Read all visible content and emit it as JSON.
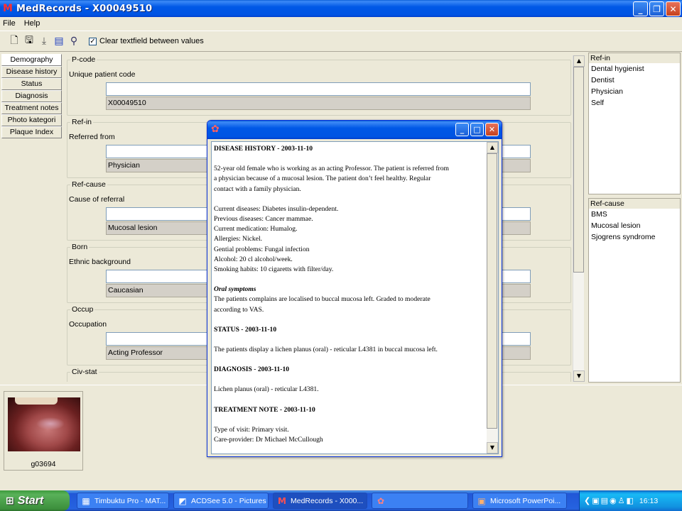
{
  "window": {
    "title": "MedRecords - X00049510",
    "app_icon": "M"
  },
  "menu": [
    "File",
    "Help"
  ],
  "toolbar": {
    "icons": [
      "new-record-icon",
      "save-icon",
      "download-icon",
      "chart-icon",
      "search-icon"
    ],
    "checkbox_label": "Clear textfield between values",
    "checkbox_checked": true
  },
  "nav": [
    "Demography",
    "Disease history",
    "Status",
    "Diagnosis",
    "Treatment notes",
    "Photo kategori",
    "Plaque Index"
  ],
  "form": {
    "groups": [
      {
        "legend": "P-code",
        "label": "Unique patient code",
        "input": "",
        "value": "X00049510"
      },
      {
        "legend": "Ref-in",
        "label": "Referred from",
        "input": "",
        "value": "Physician"
      },
      {
        "legend": "Ref-cause",
        "label": "Cause of referral",
        "input": "",
        "value": "Mucosal lesion"
      },
      {
        "legend": "Born",
        "label": "Ethnic background",
        "input": "",
        "value": "Caucasian"
      },
      {
        "legend": "Occup",
        "label": "Occupation",
        "input": "",
        "value": "Acting Professor"
      },
      {
        "legend": "Civ-stat",
        "label": "",
        "input": "",
        "value": ""
      }
    ]
  },
  "right_panels": {
    "ref_in": {
      "title": "Ref-in",
      "items": [
        "Dental hygienist",
        "Dentist",
        "Physician",
        "Self"
      ]
    },
    "ref_cause": {
      "title": "Ref-cause",
      "items": [
        "BMS",
        "Mucosal lesion",
        "Sjogrens syndrome"
      ]
    }
  },
  "photo": {
    "caption": "g03694"
  },
  "popup": {
    "icon": "✿",
    "lines": [
      {
        "style": "h",
        "text": "DISEASE HISTORY - 2003-11-10"
      },
      {
        "style": "gap",
        "text": ""
      },
      {
        "style": "p",
        "text": "52-year old female who is working as an acting Professor. The patient is referred from"
      },
      {
        "style": "p",
        "text": "a physician because of  a mucosal lesion. The patient don’t feel healthy. Regular"
      },
      {
        "style": "p",
        "text": "contact with a family physician."
      },
      {
        "style": "gap",
        "text": ""
      },
      {
        "style": "p",
        "text": "Current diseases: Diabetes insulin-dependent."
      },
      {
        "style": "p",
        "text": "Previous diseases: Cancer mammae."
      },
      {
        "style": "p",
        "text": "Current medication: Humalog."
      },
      {
        "style": "p",
        "text": "Allergies: Nickel."
      },
      {
        "style": "p",
        "text": "Gential problems: Fungal infection"
      },
      {
        "style": "p",
        "text": "Alcohol: 20 cl alcohol/week."
      },
      {
        "style": "p",
        "text": "Smoking habits: 10 cigaretts with filter/day."
      },
      {
        "style": "gap",
        "text": ""
      },
      {
        "style": "i",
        "text": "Oral symptoms"
      },
      {
        "style": "p",
        "text": "The patients complains are localised to buccal mucosa left. Graded to moderate"
      },
      {
        "style": "p",
        "text": "according to VAS."
      },
      {
        "style": "gap",
        "text": ""
      },
      {
        "style": "h",
        "text": "STATUS - 2003-11-10"
      },
      {
        "style": "gap",
        "text": ""
      },
      {
        "style": "p",
        "text": "The patients display a lichen planus (oral) - reticular  L4381  in buccal mucosa left."
      },
      {
        "style": "gap",
        "text": ""
      },
      {
        "style": "h",
        "text": "DIAGNOSIS - 2003-11-10"
      },
      {
        "style": "gap",
        "text": ""
      },
      {
        "style": "p",
        "text": "Lichen planus (oral) - reticular  L4381."
      },
      {
        "style": "gap",
        "text": ""
      },
      {
        "style": "h",
        "text": "TREATMENT NOTE - 2003-11-10"
      },
      {
        "style": "gap",
        "text": ""
      },
      {
        "style": "p",
        "text": "Type of visit: Primary visit."
      },
      {
        "style": "p",
        "text": "Care-provider: Dr Michael McCullough"
      }
    ]
  },
  "taskbar": {
    "start_label": "Start",
    "items": [
      {
        "label": "Timbuktu Pro - MAT...",
        "icon": "▦",
        "active": false
      },
      {
        "label": "ACDSee 5.0 - Pictures",
        "icon": "◩",
        "active": false
      },
      {
        "label": "MedRecords - X000...",
        "icon": "M",
        "active": true
      },
      {
        "label": "",
        "icon": "✿",
        "active": false
      },
      {
        "label": "Microsoft PowerPoi...",
        "icon": "▣",
        "active": false
      }
    ],
    "clock": "16:13"
  }
}
